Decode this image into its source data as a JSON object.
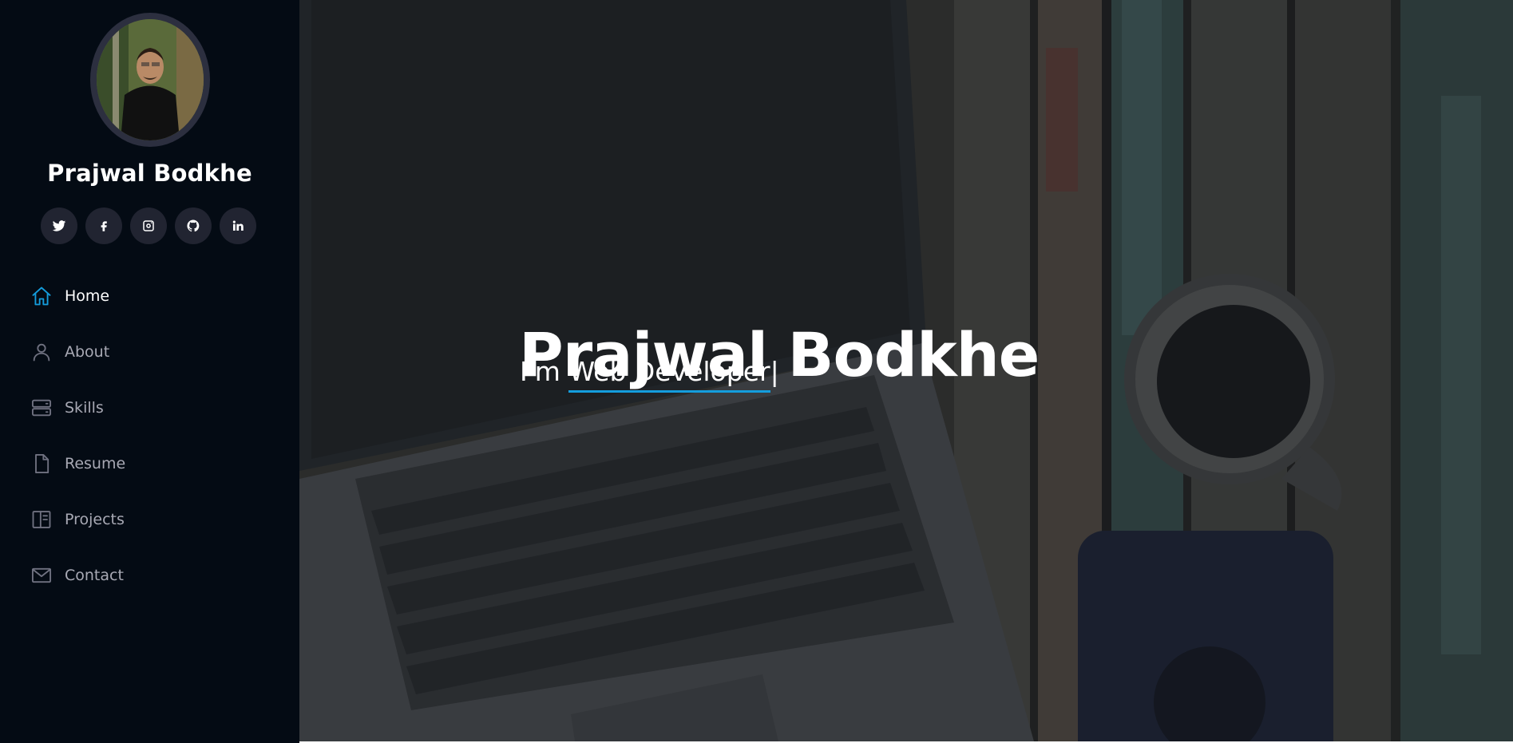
{
  "profile": {
    "name": "Prajwal Bodkhe",
    "avatar_icon": "profile-photo"
  },
  "social": [
    {
      "name": "twitter-icon"
    },
    {
      "name": "facebook-icon"
    },
    {
      "name": "instagram-icon"
    },
    {
      "name": "github-icon"
    },
    {
      "name": "linkedin-icon"
    }
  ],
  "nav": {
    "items": [
      {
        "label": "Home",
        "icon": "home-icon",
        "active": true
      },
      {
        "label": "About",
        "icon": "person-icon",
        "active": false
      },
      {
        "label": "Skills",
        "icon": "server-icon",
        "active": false
      },
      {
        "label": "Resume",
        "icon": "file-icon",
        "active": false
      },
      {
        "label": "Projects",
        "icon": "book-icon",
        "active": false
      },
      {
        "label": "Contact",
        "icon": "envelope-icon",
        "active": false
      }
    ]
  },
  "hero": {
    "title": "Prajwal Bodkhe",
    "subtitle_prefix": "I'm ",
    "typed": "Web Developer",
    "cursor": "|"
  },
  "colors": {
    "accent": "#149ddd",
    "sidebar_bg": "#040b14",
    "social_bg": "#212431"
  }
}
